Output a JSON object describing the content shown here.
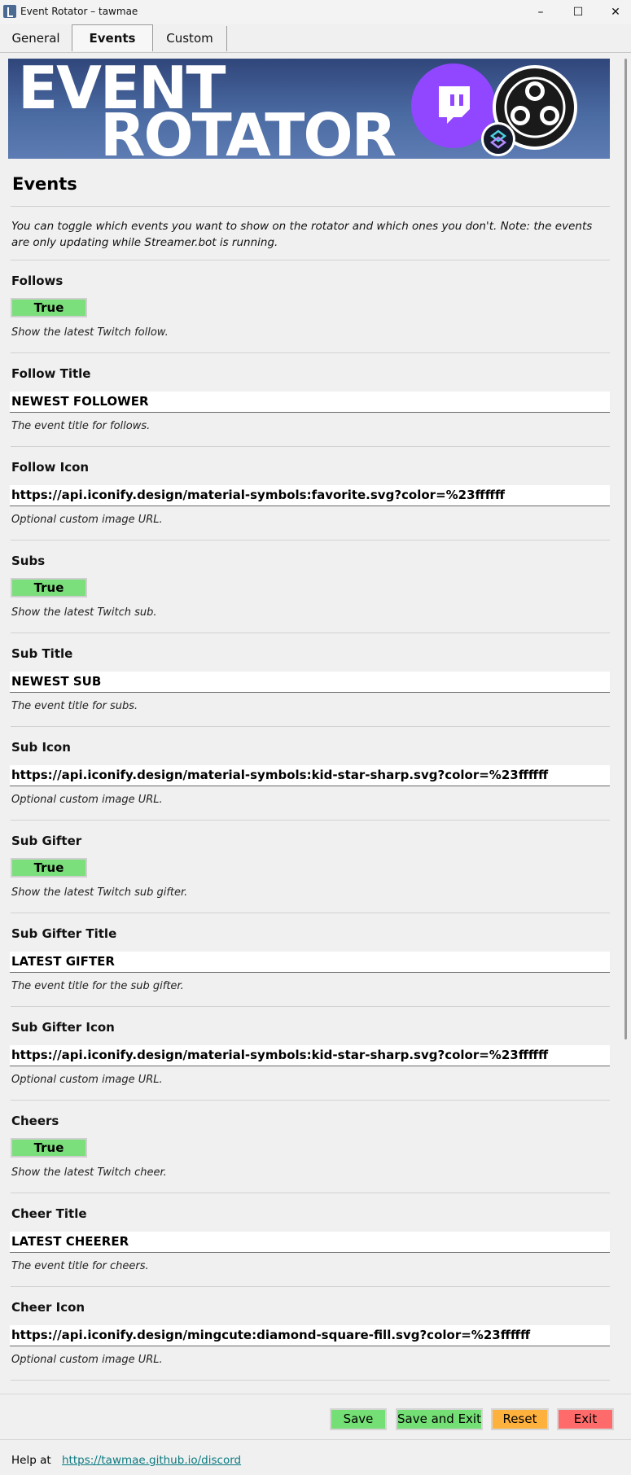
{
  "window": {
    "title": "Event Rotator – tawmae",
    "minimize": "–",
    "maximize": "☐",
    "close": "✕"
  },
  "tabs": [
    {
      "label": "General"
    },
    {
      "label": "Events"
    },
    {
      "label": "Custom"
    }
  ],
  "banner": {
    "line1": "EVENT",
    "line2": "ROTATOR"
  },
  "section": {
    "title": "Events",
    "intro": "You can toggle which events you want to show on the rotator and which ones you don't. Note: the events are only updating while Streamer.bot is running."
  },
  "fields": [
    {
      "label": "Follows",
      "type": "toggle",
      "value": "True",
      "hint": "Show the latest Twitch follow."
    },
    {
      "label": "Follow Title",
      "type": "text",
      "value": "NEWEST FOLLOWER",
      "hint": "The event title for follows."
    },
    {
      "label": "Follow Icon",
      "type": "text",
      "value": "https://api.iconify.design/material-symbols:favorite.svg?color=%23ffffff",
      "hint": "Optional custom image URL."
    },
    {
      "label": "Subs",
      "type": "toggle",
      "value": "True",
      "hint": "Show the latest Twitch sub."
    },
    {
      "label": "Sub Title",
      "type": "text",
      "value": "NEWEST SUB",
      "hint": "The event title for subs."
    },
    {
      "label": "Sub Icon",
      "type": "text",
      "value": "https://api.iconify.design/material-symbols:kid-star-sharp.svg?color=%23ffffff",
      "hint": "Optional custom image URL."
    },
    {
      "label": "Sub Gifter",
      "type": "toggle",
      "value": "True",
      "hint": "Show the latest Twitch sub gifter."
    },
    {
      "label": "Sub Gifter Title",
      "type": "text",
      "value": "LATEST GIFTER",
      "hint": "The event title for the sub gifter."
    },
    {
      "label": "Sub Gifter Icon",
      "type": "text",
      "value": "https://api.iconify.design/material-symbols:kid-star-sharp.svg?color=%23ffffff",
      "hint": "Optional custom image URL."
    },
    {
      "label": "Cheers",
      "type": "toggle",
      "value": "True",
      "hint": "Show the latest Twitch cheer."
    },
    {
      "label": "Cheer Title",
      "type": "text",
      "value": "LATEST CHEERER",
      "hint": "The event title for cheers."
    },
    {
      "label": "Cheer Icon",
      "type": "text",
      "value": "https://api.iconify.design/mingcute:diamond-square-fill.svg?color=%23ffffff",
      "hint": "Optional custom image URL."
    }
  ],
  "buttons": {
    "save": "Save",
    "save_exit": "Save and Exit",
    "reset": "Reset",
    "exit": "Exit"
  },
  "footer": {
    "help_label": "Help at",
    "help_link": "https://tawmae.github.io/discord"
  },
  "colors": {
    "toggle_on": "#7bdf7b",
    "save": "#74df74",
    "reset": "#ffb13d",
    "exit": "#ff6b6b",
    "link": "#0b7a80",
    "twitch": "#9146ff"
  }
}
